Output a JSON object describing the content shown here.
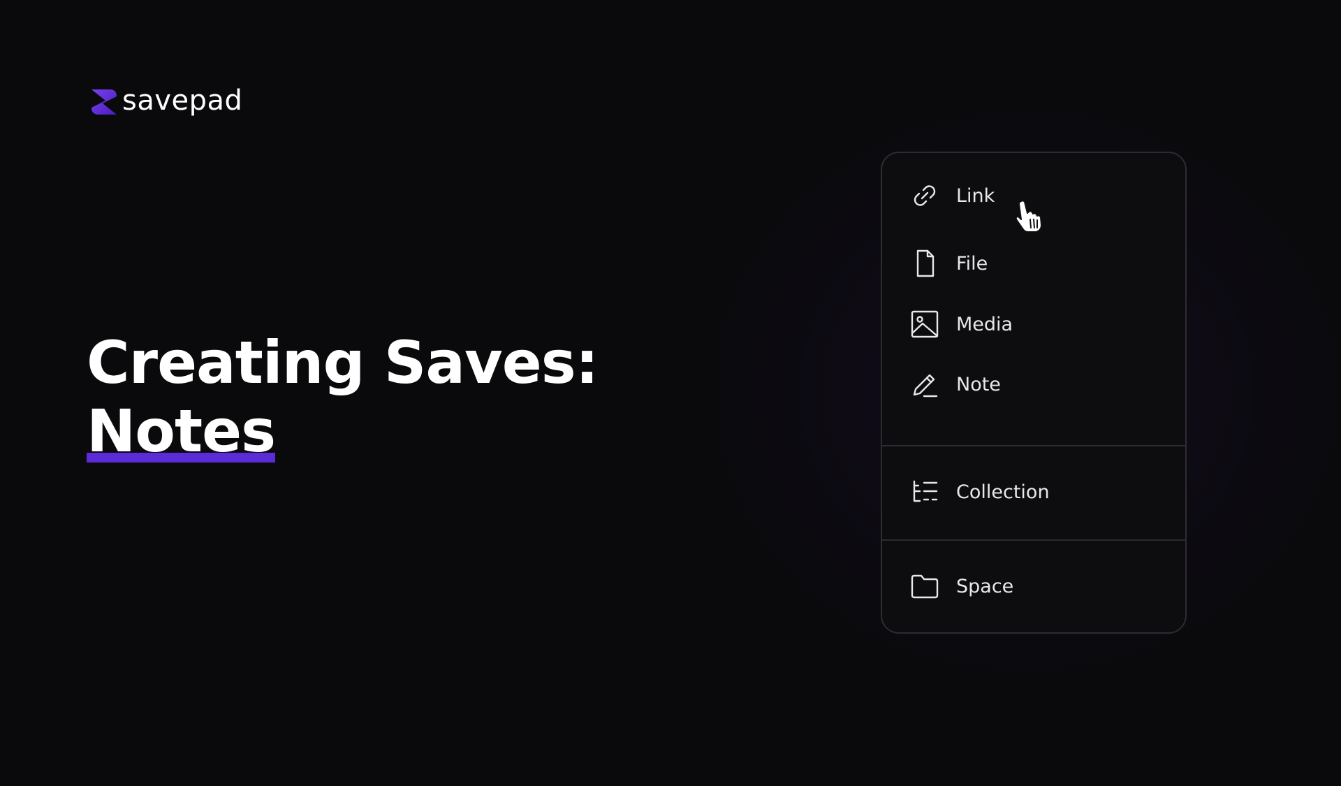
{
  "brand": {
    "name": "savepad",
    "logo_icon": "savepad-logo-icon",
    "accent_color": "#5b2bd8"
  },
  "headline": {
    "line1": "Creating Saves:",
    "line2": "Notes"
  },
  "menu": {
    "primary_items": [
      {
        "label": "Link",
        "icon": "link-icon"
      },
      {
        "label": "File",
        "icon": "file-icon"
      },
      {
        "label": "Media",
        "icon": "image-icon"
      },
      {
        "label": "Note",
        "icon": "pencil-icon"
      }
    ],
    "collection_item": {
      "label": "Collection",
      "icon": "collection-icon"
    },
    "space_item": {
      "label": "Space",
      "icon": "folder-icon"
    }
  },
  "cursor": {
    "icon": "hand-pointer-icon"
  }
}
